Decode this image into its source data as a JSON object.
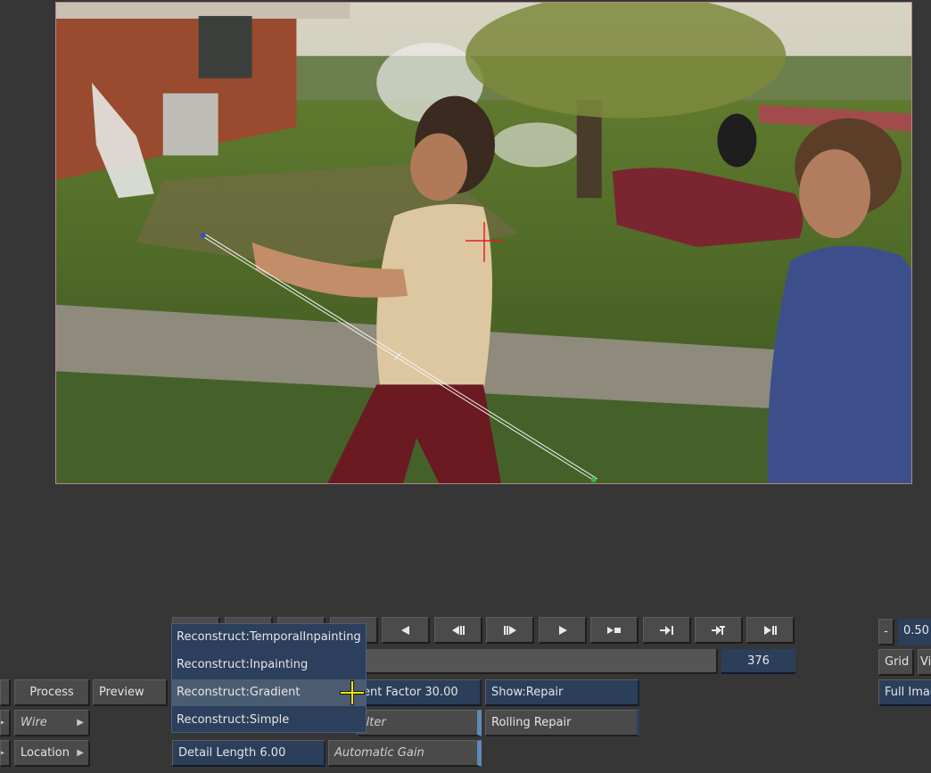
{
  "viewer": {
    "description": "video frame"
  },
  "transport": {
    "buttons": [
      {
        "name": "transport-btn-1",
        "label": ""
      },
      {
        "name": "transport-btn-2",
        "label": ""
      },
      {
        "name": "transport-btn-3",
        "label": ""
      },
      {
        "name": "transport-btn-4",
        "label": ""
      },
      {
        "name": "prev-frame-button",
        "icon": "triangle-left-icon"
      },
      {
        "name": "step-back-button",
        "icon": "step-back-icon"
      },
      {
        "name": "step-forward-button",
        "icon": "step-forward-icon"
      },
      {
        "name": "play-button",
        "icon": "play-icon"
      },
      {
        "name": "play-stop-button",
        "icon": "play-stop-icon"
      },
      {
        "name": "goto-next-button",
        "icon": "goto-next-icon"
      },
      {
        "name": "goto-end-button",
        "icon": "goto-end-icon"
      },
      {
        "name": "play-pause-end-button",
        "icon": "play-pause-icon"
      }
    ],
    "frame_value": "376"
  },
  "right_panel": {
    "minus_label": "-",
    "zoom_value": "0.50",
    "grid_label": "Grid",
    "vi_label": "Vi",
    "full_image_label": "Full Imag"
  },
  "left_panel": {
    "process_label": "Process",
    "preview_label": "Preview",
    "wire_label": "Wire",
    "location_label": "Location"
  },
  "params": {
    "factor_label": "ent Factor 30.00",
    "filter_label": "ilter",
    "show_repair_label": "Show:Repair",
    "rolling_repair_label": "Rolling Repair",
    "detail_length_label": "Detail Length 6.00",
    "automatic_gain_label": "Automatic Gain"
  },
  "dropdown": {
    "items": [
      {
        "label": "Reconstruct:TemporalInpainting",
        "highlighted": false
      },
      {
        "label": "Reconstruct:Inpainting",
        "highlighted": false
      },
      {
        "label": "Reconstruct:Gradient",
        "highlighted": true
      },
      {
        "label": "Reconstruct:Simple",
        "highlighted": false
      }
    ]
  },
  "colors": {
    "background": "#363636",
    "button": "#4a4a4a",
    "blue_button": "#2b3f5b",
    "accent_edge": "#5f89b6",
    "cursor": "#f2e600"
  }
}
